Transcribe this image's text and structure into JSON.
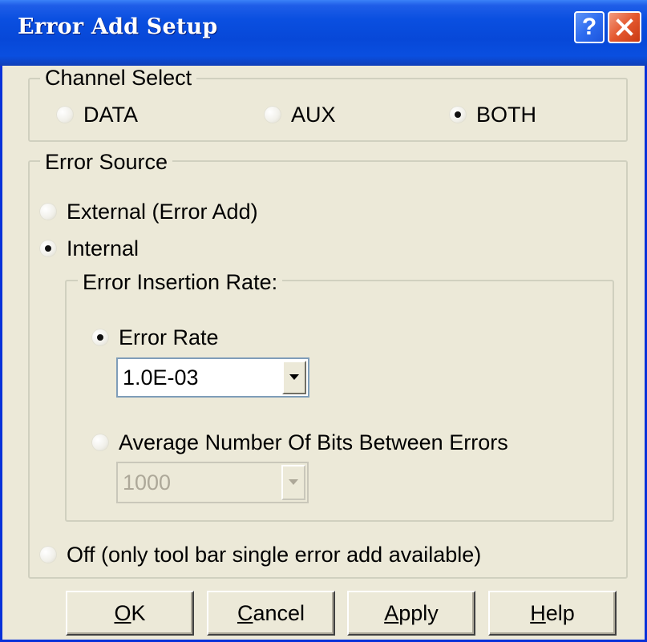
{
  "window": {
    "title": "Error Add Setup",
    "help_glyph": "?",
    "close_icon": "close-x-icon"
  },
  "channel_select": {
    "title": "Channel Select",
    "options": [
      {
        "label": "DATA",
        "selected": false
      },
      {
        "label": "AUX",
        "selected": false
      },
      {
        "label": "BOTH",
        "selected": true
      }
    ]
  },
  "error_source": {
    "title": "Error Source",
    "external": {
      "label": "External (Error Add)",
      "selected": false
    },
    "internal": {
      "label": "Internal",
      "selected": true
    },
    "insertion_rate": {
      "title": "Error Insertion Rate:",
      "error_rate": {
        "label": "Error Rate",
        "selected": true,
        "value": "1.0E-03",
        "enabled": true
      },
      "avg_bits": {
        "label": "Average Number Of Bits Between Errors",
        "selected": false,
        "value": "1000",
        "enabled": false
      }
    },
    "off": {
      "label": "Off (only tool bar single error add available)",
      "selected": false
    }
  },
  "buttons": {
    "ok": {
      "mnemonic": "O",
      "rest": "K"
    },
    "cancel": {
      "mnemonic": "C",
      "rest": "ancel"
    },
    "apply": {
      "mnemonic": "A",
      "rest": "pply"
    },
    "help": {
      "mnemonic": "H",
      "rest": "elp"
    }
  },
  "colors": {
    "titlebar": "#0a4fe0",
    "dialog_bg": "#ece9d8",
    "close_button": "#e4582e",
    "frame_border": "#0831d9"
  }
}
